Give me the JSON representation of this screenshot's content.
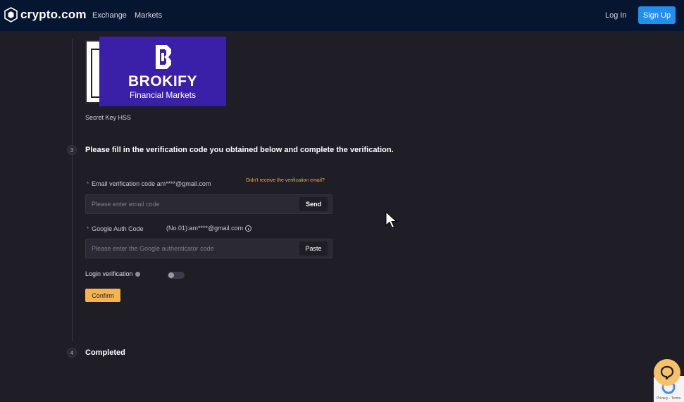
{
  "header": {
    "brand": "crypto.com",
    "nav": [
      "Exchange",
      "Markets"
    ],
    "login_label": "Log In",
    "signup_label": "Sign Up"
  },
  "banner": {
    "brand_name": "BROKIFY",
    "brand_sub": "Financial Markets"
  },
  "secret_key_label": "Secret Key HSS",
  "steps": [
    {
      "number": "3",
      "title": "Please fill in the verification code you obtained below and complete the verification."
    },
    {
      "number": "4",
      "title": "Completed"
    }
  ],
  "form": {
    "email_label": "Email verification code am****@gmail.com",
    "email_help": "Didn't receive the verification email?",
    "email_placeholder": "Please enter email code",
    "email_button": "Send",
    "google_label": "Google Auth Code",
    "google_account": "(No.01):am****@gmail.com",
    "google_placeholder": "Please enter the Google authenticator code",
    "google_button": "Paste",
    "login_verification_label": "Login verification",
    "login_verification_on": false,
    "confirm_label": "Confirm",
    "required_mark": "*"
  },
  "recaptcha_text": "Privacy - Terms",
  "colors": {
    "accent": "#f3b552",
    "brand_blue": "#1f8ff0",
    "header_bg": "#061630",
    "page_bg": "#1f1d26",
    "banner_bg": "#3a1fa8"
  },
  "icons": {
    "logo": "crypto-lion-shield-icon",
    "info": "info-circle-icon",
    "cursor": "mouse-pointer-icon",
    "chat": "chat-bubble-icon",
    "recaptcha": "recaptcha-icon"
  }
}
